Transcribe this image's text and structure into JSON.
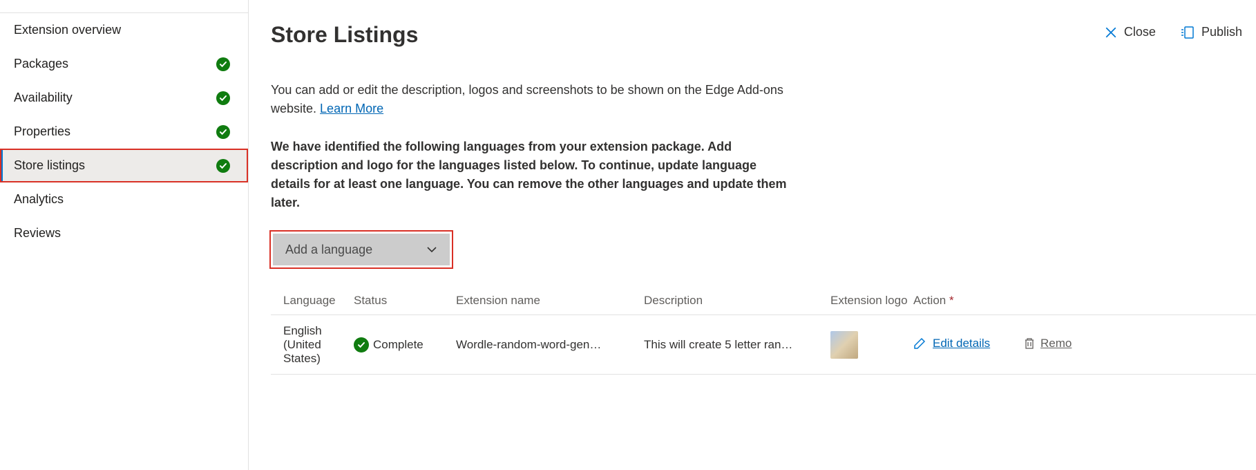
{
  "nav": {
    "items": [
      {
        "label": "Extension overview",
        "complete": false
      },
      {
        "label": "Packages",
        "complete": true
      },
      {
        "label": "Availability",
        "complete": true
      },
      {
        "label": "Properties",
        "complete": true
      },
      {
        "label": "Store listings",
        "complete": true
      },
      {
        "label": "Analytics",
        "complete": false
      },
      {
        "label": "Reviews",
        "complete": false
      }
    ]
  },
  "header": {
    "title": "Store Listings",
    "close_label": "Close",
    "publish_label": "Publish"
  },
  "description_text": "You can add or edit the description, logos and screenshots to be shown on the Edge Add-ons website. ",
  "learn_more": "Learn More",
  "instructions": "We have identified the following languages from your extension package. Add description and logo for the languages listed below. To continue, update language details for at least one language. You can remove the other languages and update them later.",
  "language_dropdown": {
    "label": "Add a language"
  },
  "table": {
    "headers": {
      "language": "Language",
      "status": "Status",
      "extension": "Extension name",
      "description": "Description",
      "logo": "Extension logo",
      "action": "Action"
    },
    "row": {
      "language": "English (United States)",
      "status": "Complete",
      "extension": "Wordle-random-word-gen…",
      "description": "This will create 5 letter ran…",
      "edit": "Edit details",
      "remove": "Remo"
    }
  }
}
